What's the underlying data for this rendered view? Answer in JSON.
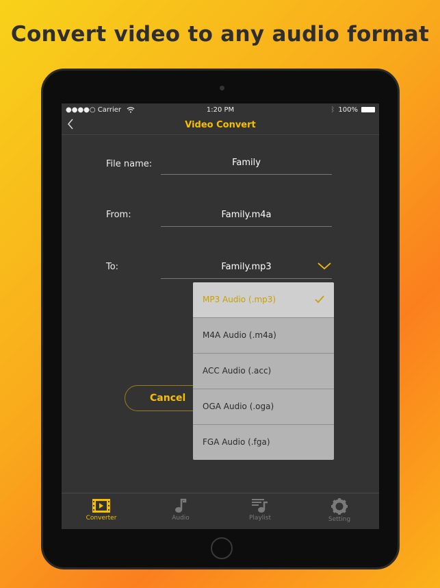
{
  "headline": "Convert video to any audio format",
  "status": {
    "signal": "●●●●○ Carrier",
    "time": "1:20 PM",
    "battery": "100%",
    "icons": [
      "wifi-icon",
      "bluetooth-icon",
      "battery-icon"
    ]
  },
  "nav": {
    "title": "Video Convert",
    "back_icon": "chevron-left-icon"
  },
  "form": {
    "file_name": {
      "label": "File name:",
      "value": "Family"
    },
    "from": {
      "label": "From:",
      "value": "Family.m4a"
    },
    "to": {
      "label": "To:",
      "value": "Family.mp3"
    }
  },
  "dropdown": {
    "options": [
      {
        "label": "MP3 Audio (.mp3)",
        "selected": true
      },
      {
        "label": "M4A Audio (.m4a)"
      },
      {
        "label": "ACC Audio (.acc)"
      },
      {
        "label": "OGA Audio (.oga)"
      },
      {
        "label": "FGA Audio (.fga)"
      }
    ]
  },
  "buttons": {
    "cancel": "Cancel"
  },
  "tabs": [
    {
      "label": "Converter",
      "icon": "film-icon",
      "active": true
    },
    {
      "label": "Audio",
      "icon": "music-note-icon"
    },
    {
      "label": "Playlist",
      "icon": "playlist-icon"
    },
    {
      "label": "Setting",
      "icon": "gear-icon"
    }
  ],
  "colors": {
    "accent": "#f5c000",
    "screen": "#333333"
  }
}
